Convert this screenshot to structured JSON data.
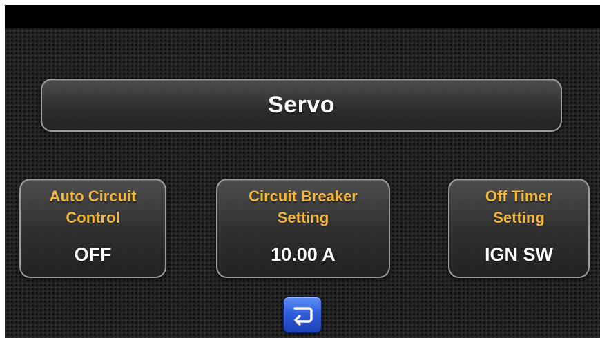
{
  "header": {
    "title": "Servo"
  },
  "tiles": [
    {
      "label": "Auto Circuit\nControl",
      "value": "OFF"
    },
    {
      "label": "Circuit Breaker\nSetting",
      "value": "10.00 A"
    },
    {
      "label": "Off Timer\nSetting",
      "value": "IGN SW"
    }
  ],
  "nav": {
    "back_icon": "return-arrow-icon"
  },
  "colors": {
    "label": "#f4b73a",
    "value": "#ffffff",
    "button": "#2f5fdc"
  }
}
